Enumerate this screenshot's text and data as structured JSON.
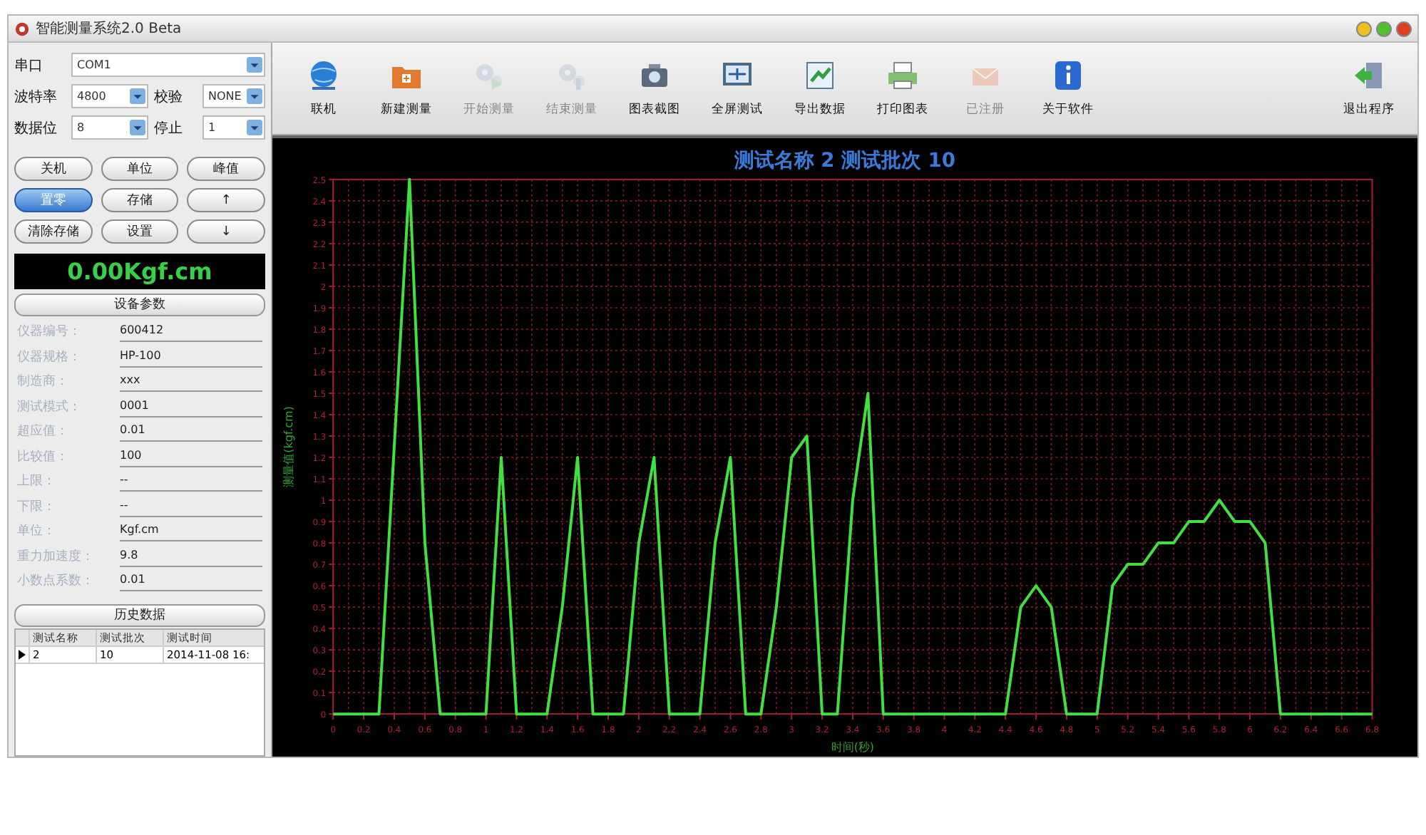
{
  "window": {
    "title": "智能测量系统2.0 Beta"
  },
  "port_settings": [
    {
      "label": "串口",
      "value": "COM1"
    },
    {
      "label": "波特率",
      "value": "4800"
    },
    {
      "label": "校验",
      "value": "NONE"
    },
    {
      "label": "数据位",
      "value": "8"
    },
    {
      "label": "停止",
      "value": "1"
    }
  ],
  "control_buttons": [
    {
      "label": "关机",
      "selected": false
    },
    {
      "label": "单位",
      "selected": false
    },
    {
      "label": "峰值",
      "selected": false
    },
    {
      "label": "置零",
      "selected": true
    },
    {
      "label": "存储",
      "selected": false
    },
    {
      "label": "↑",
      "selected": false
    },
    {
      "label": "清除存储",
      "selected": false
    },
    {
      "label": "设置",
      "selected": false
    },
    {
      "label": "↓",
      "selected": false
    }
  ],
  "display": {
    "reading": "0.00Kgf.cm"
  },
  "device_params": {
    "title": "设备参数",
    "rows": [
      {
        "label": "仪器编号：",
        "value": "600412"
      },
      {
        "label": "仪器规格：",
        "value": "HP-100"
      },
      {
        "label": "制造商：",
        "value": "xxx"
      },
      {
        "label": "测试模式：",
        "value": "0001"
      },
      {
        "label": "超应值：",
        "value": "0.01"
      },
      {
        "label": "比较值：",
        "value": "100"
      },
      {
        "label": "上限：",
        "value": "--"
      },
      {
        "label": "下限：",
        "value": "--"
      },
      {
        "label": "单位：",
        "value": "Kgf.cm"
      },
      {
        "label": "重力加速度：",
        "value": "9.8"
      },
      {
        "label": "小数点系数：",
        "value": "0.01"
      }
    ]
  },
  "history": {
    "title": "历史数据",
    "columns": [
      "测试名称",
      "测试批次",
      "测试时间"
    ],
    "rows": [
      {
        "selected": true,
        "cells": [
          "2",
          "10",
          "2014-11-08 16:"
        ]
      }
    ]
  },
  "toolbar": {
    "items": [
      {
        "label": "联机",
        "disabled": false
      },
      {
        "label": "新建测量",
        "disabled": false
      },
      {
        "label": "开始测量",
        "disabled": true
      },
      {
        "label": "结束测量",
        "disabled": true
      },
      {
        "label": "图表截图",
        "disabled": false
      },
      {
        "label": "全屏测试",
        "disabled": false
      },
      {
        "label": "导出数据",
        "disabled": false
      },
      {
        "label": "打印图表",
        "disabled": false
      },
      {
        "label": "已注册",
        "disabled": true
      },
      {
        "label": "关于软件",
        "disabled": false
      }
    ],
    "exit": {
      "label": "退出程序",
      "disabled": false
    }
  },
  "chart": {
    "chart_data": {
      "type": "line",
      "grid": true,
      "title": "测试名称 2 测试批次 10",
      "xlabel": "时间(秒)",
      "ylabel": "测量值(kgf.cm)",
      "xlim": [
        0,
        6.8
      ],
      "ylim": [
        0,
        2.5
      ],
      "xticks": [
        0,
        0.2,
        0.4,
        0.6,
        0.8,
        1,
        1.2,
        1.4,
        1.6,
        1.8,
        2,
        2.2,
        2.4,
        2.6,
        2.8,
        3,
        3.2,
        3.4,
        3.6,
        3.8,
        4,
        4.2,
        4.4,
        4.6,
        4.8,
        5,
        5.2,
        5.4,
        5.6,
        5.8,
        6,
        6.2,
        6.4,
        6.6,
        6.8
      ],
      "yticks": [
        0,
        0.1,
        0.2,
        0.3,
        0.4,
        0.5,
        0.6,
        0.7,
        0.8,
        0.9,
        1,
        1.1,
        1.2,
        1.3,
        1.4,
        1.5,
        1.6,
        1.7,
        1.8,
        1.9,
        2,
        2.1,
        2.2,
        2.3,
        2.4,
        2.5
      ],
      "x": [
        0,
        0.1,
        0.2,
        0.3,
        0.4,
        0.5,
        0.6,
        0.7,
        0.8,
        0.9,
        1,
        1.1,
        1.2,
        1.3,
        1.4,
        1.5,
        1.6,
        1.7,
        1.8,
        1.9,
        2,
        2.1,
        2.2,
        2.3,
        2.4,
        2.5,
        2.6,
        2.7,
        2.8,
        2.9,
        3,
        3.1,
        3.2,
        3.3,
        3.4,
        3.5,
        3.6,
        3.7,
        3.8,
        3.9,
        4,
        4.1,
        4.2,
        4.3,
        4.4,
        4.5,
        4.6,
        4.7,
        4.8,
        4.9,
        5,
        5.1,
        5.2,
        5.3,
        5.4,
        5.5,
        5.6,
        5.7,
        5.8,
        5.9,
        6,
        6.1,
        6.2,
        6.3,
        6.4,
        6.5,
        6.6,
        6.7,
        6.8
      ],
      "series": [
        {
          "color": "#40e040",
          "values": [
            0,
            0,
            0,
            0,
            1.25,
            2.5,
            0.8,
            0,
            0,
            0,
            0,
            1.2,
            0,
            0,
            0,
            0.5,
            1.2,
            0,
            0,
            0,
            0.8,
            1.2,
            0,
            0,
            0,
            0.8,
            1.2,
            0,
            0,
            0.5,
            1.2,
            1.3,
            0,
            0,
            1.0,
            1.5,
            0,
            0,
            0,
            0,
            0,
            0,
            0,
            0,
            0,
            0.5,
            0.6,
            0.5,
            0,
            0,
            0,
            0.6,
            0.7,
            0.7,
            0.8,
            0.8,
            0.9,
            0.9,
            1.0,
            0.9,
            0.9,
            0.8,
            0,
            0,
            0,
            0,
            0,
            0,
            0
          ]
        }
      ]
    }
  }
}
